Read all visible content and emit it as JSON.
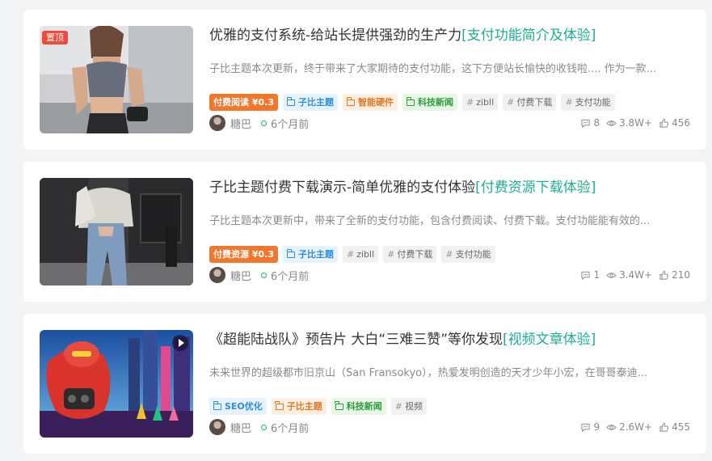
{
  "posts": [
    {
      "badge": "置顶",
      "title_main": "优雅的支付系统-给站长提供强劲的生产力",
      "title_sub": "[支付功能简介及体验]",
      "excerpt": "子比主题本次更新，终于带来了大家期待的支付功能，这下方便站长愉快的收钱啦.... 作为一款...",
      "tags": [
        {
          "label": "付费阅读 ¥0.3",
          "style": "pay",
          "icon": ""
        },
        {
          "label": "子比主题",
          "style": "blue",
          "icon": "folder-icon"
        },
        {
          "label": "智能硬件",
          "style": "orange",
          "icon": "folder-icon"
        },
        {
          "label": "科技新闻",
          "style": "green",
          "icon": "folder-icon"
        },
        {
          "label": "zibll",
          "style": "gray",
          "icon": "hash"
        },
        {
          "label": "付费下载",
          "style": "gray",
          "icon": "hash"
        },
        {
          "label": "支付功能",
          "style": "gray",
          "icon": "hash"
        }
      ],
      "author": "糖巴",
      "time": "6个月前",
      "comments": "8",
      "views": "3.8W+",
      "likes": "456"
    },
    {
      "badge": "",
      "title_main": "子比主题付费下载演示-简单优雅的支付体验",
      "title_sub": "[付费资源下载体验]",
      "excerpt": "子比主题本次更新中，带来了全新的支付功能，包含付费阅读、付费下载。支付功能能有效的...",
      "tags": [
        {
          "label": "付费资源 ¥0.3",
          "style": "pay",
          "icon": ""
        },
        {
          "label": "子比主题",
          "style": "blue",
          "icon": "folder-icon"
        },
        {
          "label": "zibll",
          "style": "gray",
          "icon": "hash"
        },
        {
          "label": "付费下载",
          "style": "gray",
          "icon": "hash"
        },
        {
          "label": "支付功能",
          "style": "gray",
          "icon": "hash"
        }
      ],
      "author": "糖巴",
      "time": "6个月前",
      "comments": "1",
      "views": "3.4W+",
      "likes": "210"
    },
    {
      "badge": "",
      "title_main": "《超能陆战队》预告片 大白“三难三赞”等你发现",
      "title_sub": "[视频文章体验]",
      "excerpt": "未来世界的超级都市旧京山（San Fransokyo），热爱发明创造的天才少年小宏，在哥哥泰迪...",
      "tags": [
        {
          "label": "SEO优化",
          "style": "blue",
          "icon": "folder-icon"
        },
        {
          "label": "子比主题",
          "style": "orange",
          "icon": "folder-icon"
        },
        {
          "label": "科技新闻",
          "style": "green",
          "icon": "folder-icon"
        },
        {
          "label": "视频",
          "style": "gray",
          "icon": "hash"
        }
      ],
      "author": "糖巴",
      "time": "6个月前",
      "comments": "9",
      "views": "2.6W+",
      "likes": "455"
    }
  ],
  "colors": {
    "accent": "#1cad96",
    "badge": "#ef4b3a",
    "pay": "#f0772b"
  }
}
